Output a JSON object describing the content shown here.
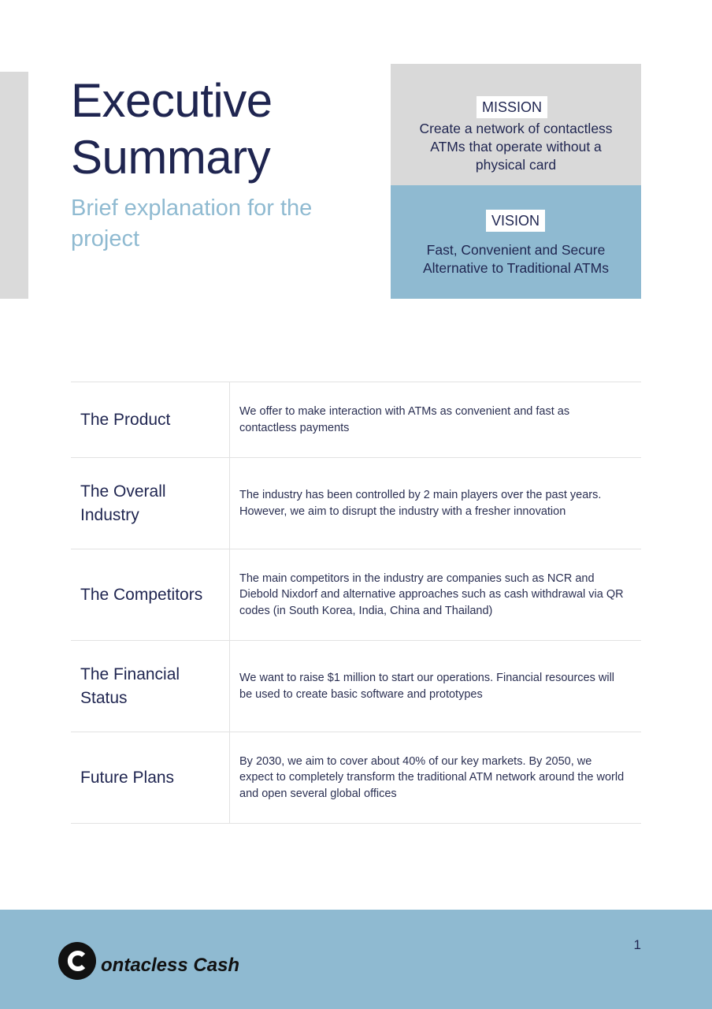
{
  "header": {
    "title": "Executive Summary",
    "subtitle": "Brief explanation for the project"
  },
  "mission": {
    "label": "MISSION",
    "text": "Create a network of contactless ATMs that operate without a physical card"
  },
  "vision": {
    "label": "VISION",
    "text": "Fast, Convenient and Secure Alternative to Traditional ATMs"
  },
  "table": {
    "rows": [
      {
        "label": "The Product",
        "description": "We offer to make interaction with ATMs as convenient and fast as contactless payments"
      },
      {
        "label": "The Overall Industry",
        "description": "The industry has been controlled by 2 main players over the past years. However, we aim to disrupt the industry with a fresher innovation"
      },
      {
        "label": "The Competitors",
        "description": "The main competitors in the industry are companies such as NCR and Diebold Nixdorf and alternative approaches such as cash withdrawal via QR codes (in South Korea, India, China and Thailand)"
      },
      {
        "label": "The Financial Status",
        "description": "We want to raise $1 million to start our operations. Financial resources will be used to create basic software and prototypes"
      },
      {
        "label": "Future Plans",
        "description": "By 2030, we aim to cover about 40% of our key markets. By 2050, we expect to completely transform the traditional ATM network around the world and open several global offices"
      }
    ]
  },
  "footer": {
    "brand_rest": "ontacless Cash",
    "logo_letter": "C",
    "page_number": "1"
  },
  "colors": {
    "accent_blue": "#8fbad1",
    "navy": "#1f2550",
    "gray_block": "#d9d9d9"
  }
}
